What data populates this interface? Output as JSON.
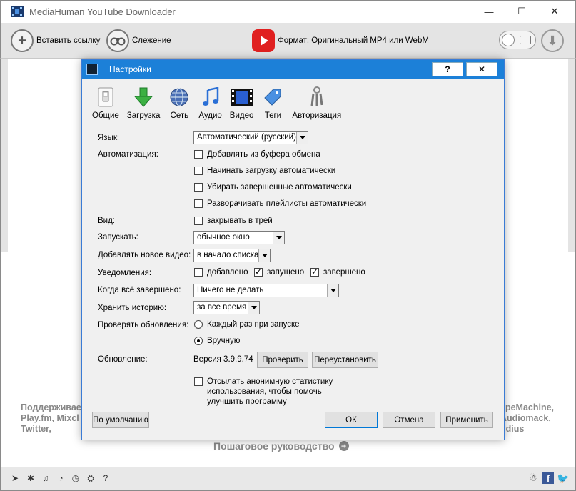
{
  "window": {
    "title": "MediaHuman YouTube Downloader",
    "min_glyph": "—",
    "max_glyph": "☐",
    "close_glyph": "✕"
  },
  "toolbar": {
    "paste_label": "Вставить ссылку",
    "tracking_label": "Слежение",
    "format_label": "Формат: Оригинальный MP4 или WebM"
  },
  "background": {
    "support_left": "Поддерживае Play.fm, Mixcl Twitter,",
    "support_right": "ypeMachine, Audiomack, udius",
    "guide_label": "Пошаговое руководство"
  },
  "dialog": {
    "title": "Настройки",
    "help_label": "?",
    "close_label": "✕",
    "tabs": [
      {
        "label": "Общие",
        "icon": "switch-icon"
      },
      {
        "label": "Загрузка",
        "icon": "download-arrow-icon"
      },
      {
        "label": "Сеть",
        "icon": "globe-icon"
      },
      {
        "label": "Аудио",
        "icon": "music-note-icon"
      },
      {
        "label": "Видео",
        "icon": "film-icon"
      },
      {
        "label": "Теги",
        "icon": "tag-icon"
      },
      {
        "label": "Авторизация",
        "icon": "keys-icon"
      }
    ],
    "language": {
      "label": "Язык:",
      "value": "Автоматический (русский)"
    },
    "automation": {
      "label": "Автоматизация:",
      "options": [
        {
          "label": "Добавлять из буфера обмена",
          "checked": false
        },
        {
          "label": "Начинать загрузку автоматически",
          "checked": false
        },
        {
          "label": "Убирать завершенные автоматически",
          "checked": false
        },
        {
          "label": "Разворачивать плейлисты автоматически",
          "checked": false
        }
      ]
    },
    "view": {
      "label": "Вид:",
      "option": "закрывать в трей",
      "checked": false
    },
    "launch": {
      "label": "Запускать:",
      "value": "обычное окно"
    },
    "add_new": {
      "label": "Добавлять новое видео:",
      "value": "в начало списка"
    },
    "notifications": {
      "label": "Уведомления:",
      "options": [
        {
          "label": "добавлено",
          "checked": false
        },
        {
          "label": "запущено",
          "checked": true
        },
        {
          "label": "завершено",
          "checked": true
        }
      ]
    },
    "when_done": {
      "label": "Когда всё завершено:",
      "value": "Ничего не делать"
    },
    "history": {
      "label": "Хранить историю:",
      "value": "за все время"
    },
    "updates": {
      "label": "Проверять обновления:",
      "options": [
        {
          "label": "Каждый раз при запуске",
          "selected": false
        },
        {
          "label": "Вручную",
          "selected": true
        }
      ]
    },
    "update": {
      "label": "Обновление:",
      "version": "Версия 3.9.9.74",
      "check_label": "Проверить",
      "reinstall_label": "Переустановить"
    },
    "stats": {
      "label": "Отсылать анонимную статистику использования, чтобы помочь улучшить программу",
      "checked": false
    },
    "buttons": {
      "defaults": "По умолчанию",
      "ok": "ОК",
      "cancel": "Отмена",
      "apply": "Применить"
    }
  },
  "colors": {
    "accent": "#1c80d8",
    "youtube": "#e02020",
    "dialog_bg": "#f0f0f0"
  }
}
